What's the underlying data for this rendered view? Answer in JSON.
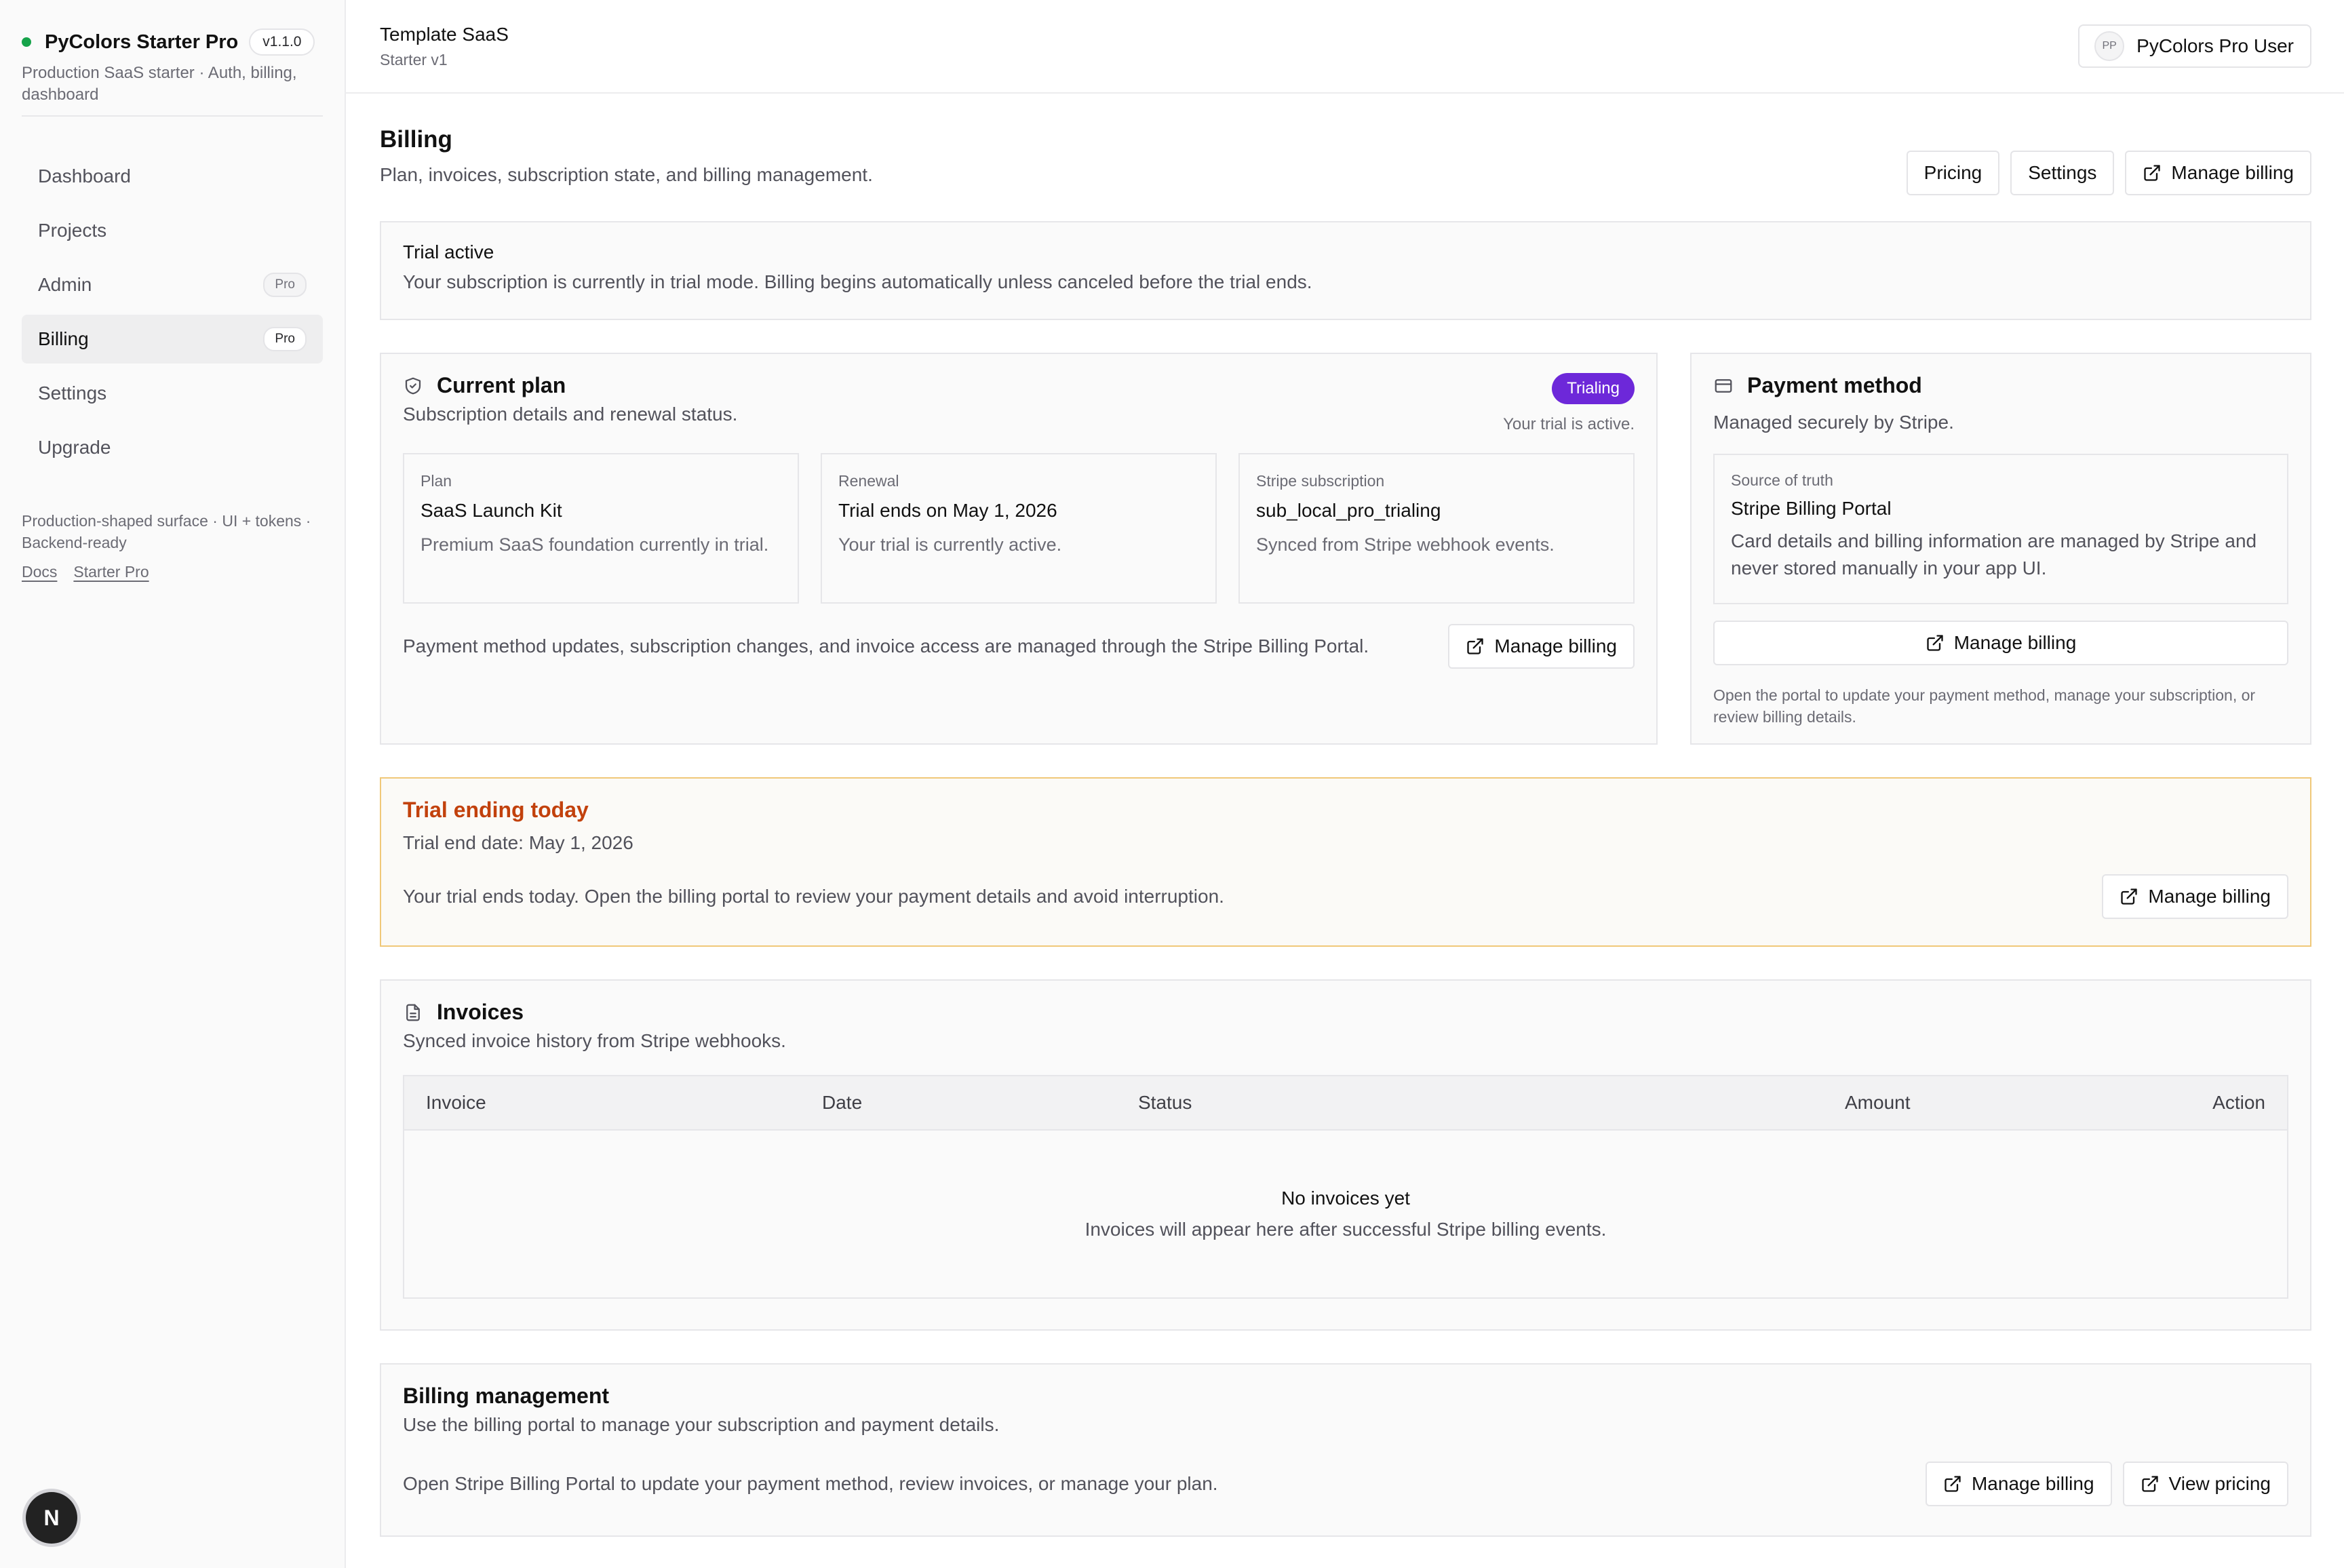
{
  "brand": {
    "name": "PyColors Starter Pro",
    "version": "v1.1.0",
    "description": "Production SaaS starter · Auth, billing, dashboard",
    "status_color": "#16a34a"
  },
  "sidebar": {
    "items": [
      {
        "label": "Dashboard",
        "badge": ""
      },
      {
        "label": "Projects",
        "badge": ""
      },
      {
        "label": "Admin",
        "badge": "Pro"
      },
      {
        "label": "Billing",
        "badge": "Pro",
        "active": true
      },
      {
        "label": "Settings",
        "badge": ""
      },
      {
        "label": "Upgrade",
        "badge": ""
      }
    ],
    "footer_text": "Production-shaped surface · UI + tokens · Backend-ready",
    "footer_links": [
      "Docs",
      "Starter Pro"
    ],
    "dev_badge": "N"
  },
  "topbar": {
    "workspace_name": "Template SaaS",
    "workspace_sub": "Starter v1",
    "user_initials": "PP",
    "user_name": "PyColors Pro User"
  },
  "page": {
    "title": "Billing",
    "subtitle": "Plan, invoices, subscription state, and billing management.",
    "actions": {
      "pricing": "Pricing",
      "settings": "Settings",
      "manage_billing": "Manage billing"
    }
  },
  "trial_alert": {
    "title": "Trial active",
    "text": "Your subscription is currently in trial mode. Billing begins automatically unless canceled before the trial ends."
  },
  "current_plan": {
    "title": "Current plan",
    "subtitle": "Subscription details and renewal status.",
    "status_badge": "Trialing",
    "status_note": "Your trial is active.",
    "stats": [
      {
        "label": "Plan",
        "value": "SaaS Launch Kit",
        "desc": "Premium SaaS foundation currently in trial."
      },
      {
        "label": "Renewal",
        "value": "Trial ends on May 1, 2026",
        "desc": "Your trial is currently active."
      },
      {
        "label": "Stripe subscription",
        "value": "sub_local_pro_trialing",
        "desc": "Synced from Stripe webhook events."
      }
    ],
    "footer_text": "Payment method updates, subscription changes, and invoice access are managed through the Stripe Billing Portal.",
    "button": "Manage billing",
    "badge_color": "#6d28d9"
  },
  "payment_method": {
    "title": "Payment method",
    "subtitle": "Managed securely by Stripe.",
    "source_label": "Source of truth",
    "source_value": "Stripe Billing Portal",
    "source_desc": "Card details and billing information are managed by Stripe and never stored manually in your app UI.",
    "button": "Manage billing",
    "note": "Open the portal to update your payment method, manage your subscription, or review billing details."
  },
  "trial_warning": {
    "title": "Trial ending today",
    "date": "Trial end date: May 1, 2026",
    "text": "Your trial ends today. Open the billing portal to review your payment details and avoid interruption.",
    "button": "Manage billing",
    "accent": "#c2410c"
  },
  "invoices": {
    "title": "Invoices",
    "subtitle": "Synced invoice history from Stripe webhooks.",
    "columns": [
      "Invoice",
      "Date",
      "Status",
      "Amount",
      "Action"
    ],
    "rows": [],
    "empty_title": "No invoices yet",
    "empty_text": "Invoices will appear here after successful Stripe billing events."
  },
  "billing_management": {
    "title": "Billing management",
    "subtitle": "Use the billing portal to manage your subscription and payment details.",
    "text": "Open Stripe Billing Portal to update your payment method, review invoices, or manage your plan.",
    "manage_button": "Manage billing",
    "pricing_button": "View pricing"
  }
}
